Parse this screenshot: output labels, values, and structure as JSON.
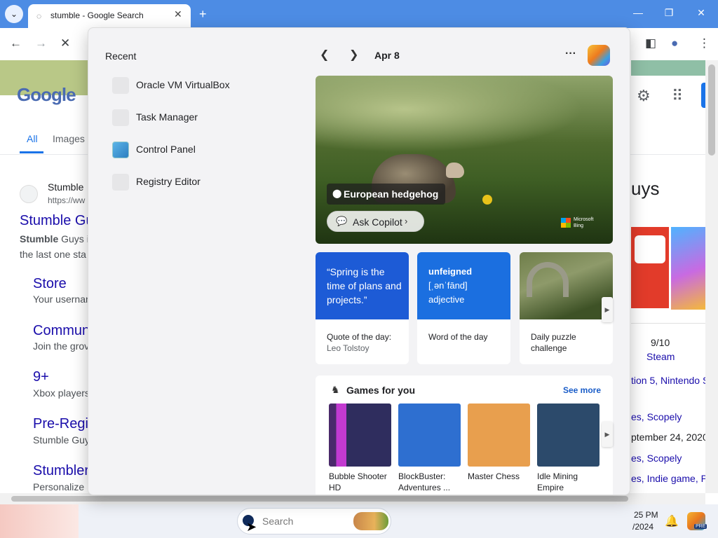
{
  "browser": {
    "tab_title": "stumble - Google Search",
    "tab_close": "✕",
    "new_tab": "+",
    "tab_list": "⌄",
    "window_controls": {
      "minimize": "—",
      "restore": "❐",
      "close": "✕"
    },
    "toolbar": {
      "back": "←",
      "forward": "→",
      "stop": "✕",
      "side_panel": "◧",
      "profile": "●",
      "menu": "⋮"
    }
  },
  "google": {
    "logo": "Google",
    "tabs": [
      "All",
      "Images"
    ],
    "result": {
      "site_name": "Stumble",
      "site_url": "https://ww",
      "title": "Stumble Gu",
      "snippet_bold": "Stumble",
      "snippet_rest": " Guys is",
      "snippet_line2": "the last one sta"
    },
    "sublinks": [
      {
        "title": "Store",
        "desc": "Your usernan"
      },
      {
        "title": "Commun",
        "desc": "Join the grov"
      },
      {
        "title": "9+",
        "desc": "Xbox players"
      },
      {
        "title": "Pre-Regis",
        "desc": "Stumble Guy"
      },
      {
        "title": "Stumbler",
        "desc": "Personalize"
      }
    ],
    "knowledge_panel": {
      "title_fragment": "uys",
      "rating": "9/10",
      "rating_source": "Steam",
      "lines": [
        "tion 5, Nintendo S",
        "es, Scopely",
        "ptember 24, 2020",
        "es, Scopely",
        "es, Indie game, Part"
      ]
    }
  },
  "widgets": {
    "recent_label": "Recent",
    "recent_items": [
      "Oracle VM VirtualBox",
      "Task Manager",
      "Control Panel",
      "Registry Editor"
    ],
    "date": "Apr 8",
    "more": "···",
    "hero": {
      "label": "European hedgehog",
      "ask": "Ask Copilot",
      "bing_text": "Microsoft Bing"
    },
    "cards": [
      {
        "top_text": "“Spring is the time of plans and projects.”",
        "bottom": "Quote of the day:",
        "bottom_sub": "Leo Tolstoy",
        "color": "#1d5bd6"
      },
      {
        "top_word": "unfeigned",
        "top_pron": "[ˌənˈfānd]",
        "top_pos": "adjective",
        "bottom": "Word of the day",
        "color": "#1b6fe0"
      },
      {
        "bottom": "Daily puzzle challenge"
      }
    ],
    "games": {
      "title": "Games for you",
      "see_more": "See more",
      "items": [
        {
          "name": "Bubble Shooter HD",
          "color": "#2f2d5e"
        },
        {
          "name": "BlockBuster: Adventures ...",
          "color": "#2e6fd0"
        },
        {
          "name": "Master Chess",
          "color": "#e89f4e"
        },
        {
          "name": "Idle Mining Empire",
          "color": "#2c4a6b"
        }
      ]
    }
  },
  "taskbar": {
    "search_placeholder": "Search",
    "time": "25 PM",
    "date": "/2024",
    "pre_badge": "PRE"
  }
}
